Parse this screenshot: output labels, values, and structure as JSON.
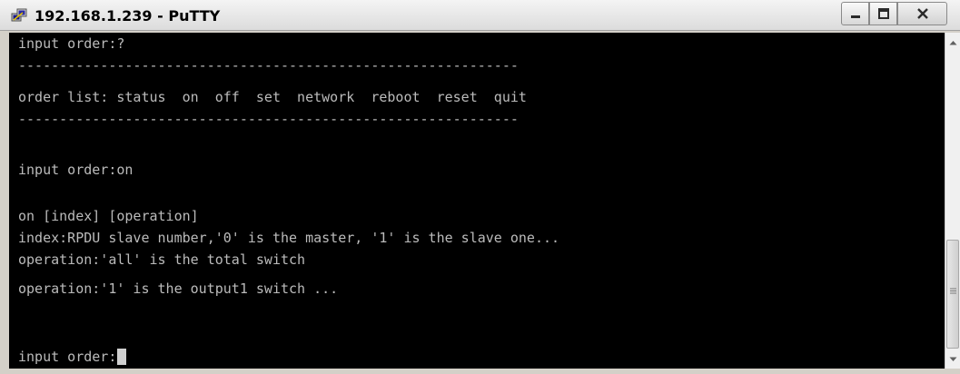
{
  "window": {
    "title": "192.168.1.239 - PuTTY",
    "controls": {
      "minimize": "minimize",
      "maximize": "maximize",
      "close": "close"
    }
  },
  "terminal": {
    "lines": [
      "input order:?",
      "-------------------------------------------------------------",
      "order list: status  on  off  set  network  reboot  reset  quit",
      "-------------------------------------------------------------",
      "",
      "input order:on",
      "",
      "on [index] [operation]",
      "index:RPDU slave number,'0' is the master, '1' is the slave one...",
      "operation:'all' is the total switch",
      "operation:'1' is the output1 switch ...",
      "",
      "",
      "input order:"
    ],
    "colors": {
      "background": "#000000",
      "foreground": "#bbbbbb",
      "cursor": "#d0d0d0"
    }
  },
  "icons": {
    "app": "putty-icon",
    "minimize": "minimize-icon",
    "maximize": "maximize-icon",
    "close": "close-icon",
    "scroll_up": "scroll-up-arrow-icon",
    "scroll_down": "scroll-down-arrow-icon"
  }
}
